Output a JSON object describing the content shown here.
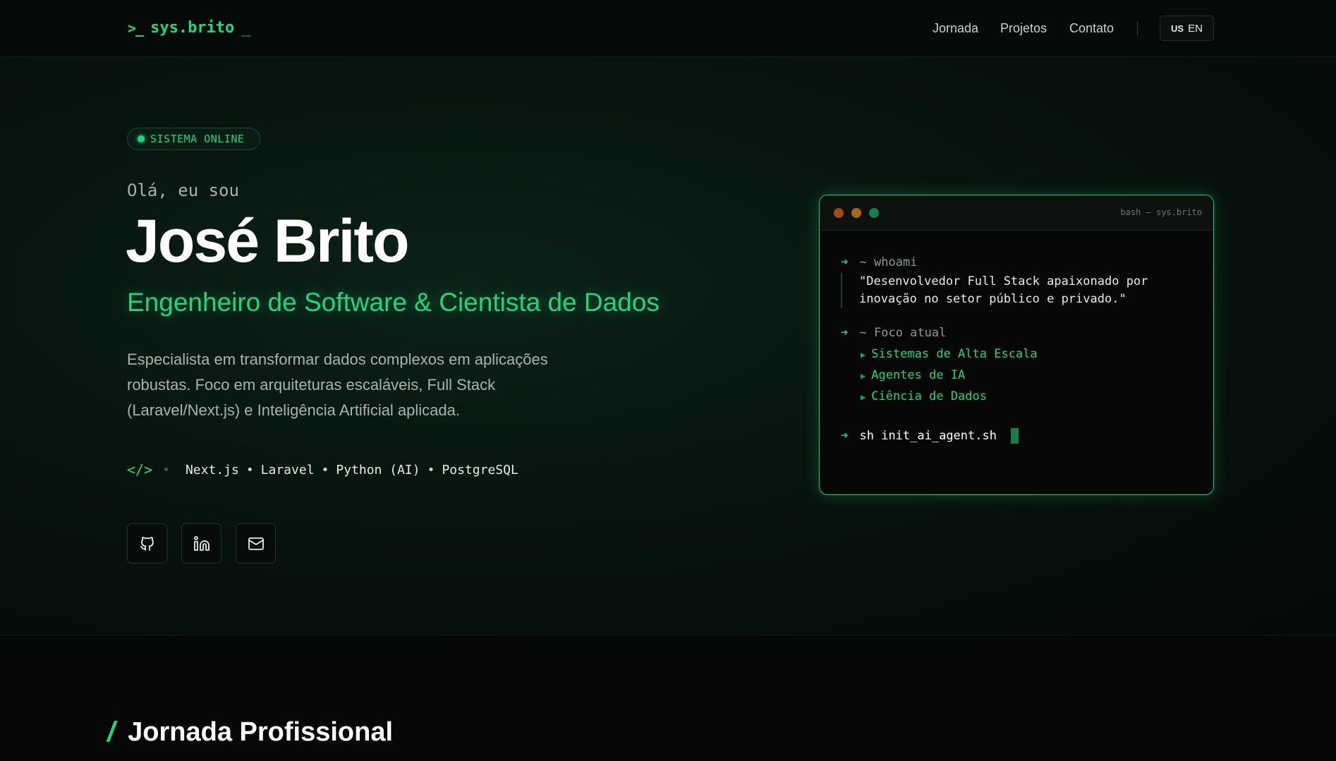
{
  "header": {
    "logo_prompt": ">_",
    "logo_text": "sys.brito",
    "logo_cursor": "_",
    "nav": [
      "Jornada",
      "Projetos",
      "Contato"
    ],
    "lang_flag": "US",
    "lang_label": "EN"
  },
  "hero": {
    "badge": "SISTEMA ONLINE",
    "greeting": "Olá, eu sou",
    "name": "José Brito",
    "role": "Engenheiro de Software & Cientista de Dados",
    "description": "Especialista em transformar dados complexos em aplicações robustas. Foco em arquiteturas escaláveis, Full Stack (Laravel/Next.js) e Inteligência Artificial aplicada.",
    "stack_icon": "</>",
    "stack": [
      "Next.js",
      "Laravel",
      "Python (AI)",
      "PostgreSQL"
    ],
    "socials": [
      "github-icon",
      "linkedin-icon",
      "mail-icon"
    ]
  },
  "terminal": {
    "title": "bash — sys.brito",
    "cmd1_tilde": "~",
    "cmd1": "whoami",
    "quote_lines": [
      "\"Desenvolvedor Full Stack apaixonado por",
      "inovação no setor público e privado.\""
    ],
    "cmd2_tilde": "~",
    "cmd2": "Foco atual",
    "focus": [
      "Sistemas de Alta Escala",
      "Agentes de IA",
      "Ciência de Dados"
    ],
    "cmd3": "sh init_ai_agent.sh"
  },
  "section": {
    "slash": "/",
    "title": "Jornada Profissional"
  },
  "colors": {
    "accent": "#22d47a",
    "background": "#050807"
  }
}
